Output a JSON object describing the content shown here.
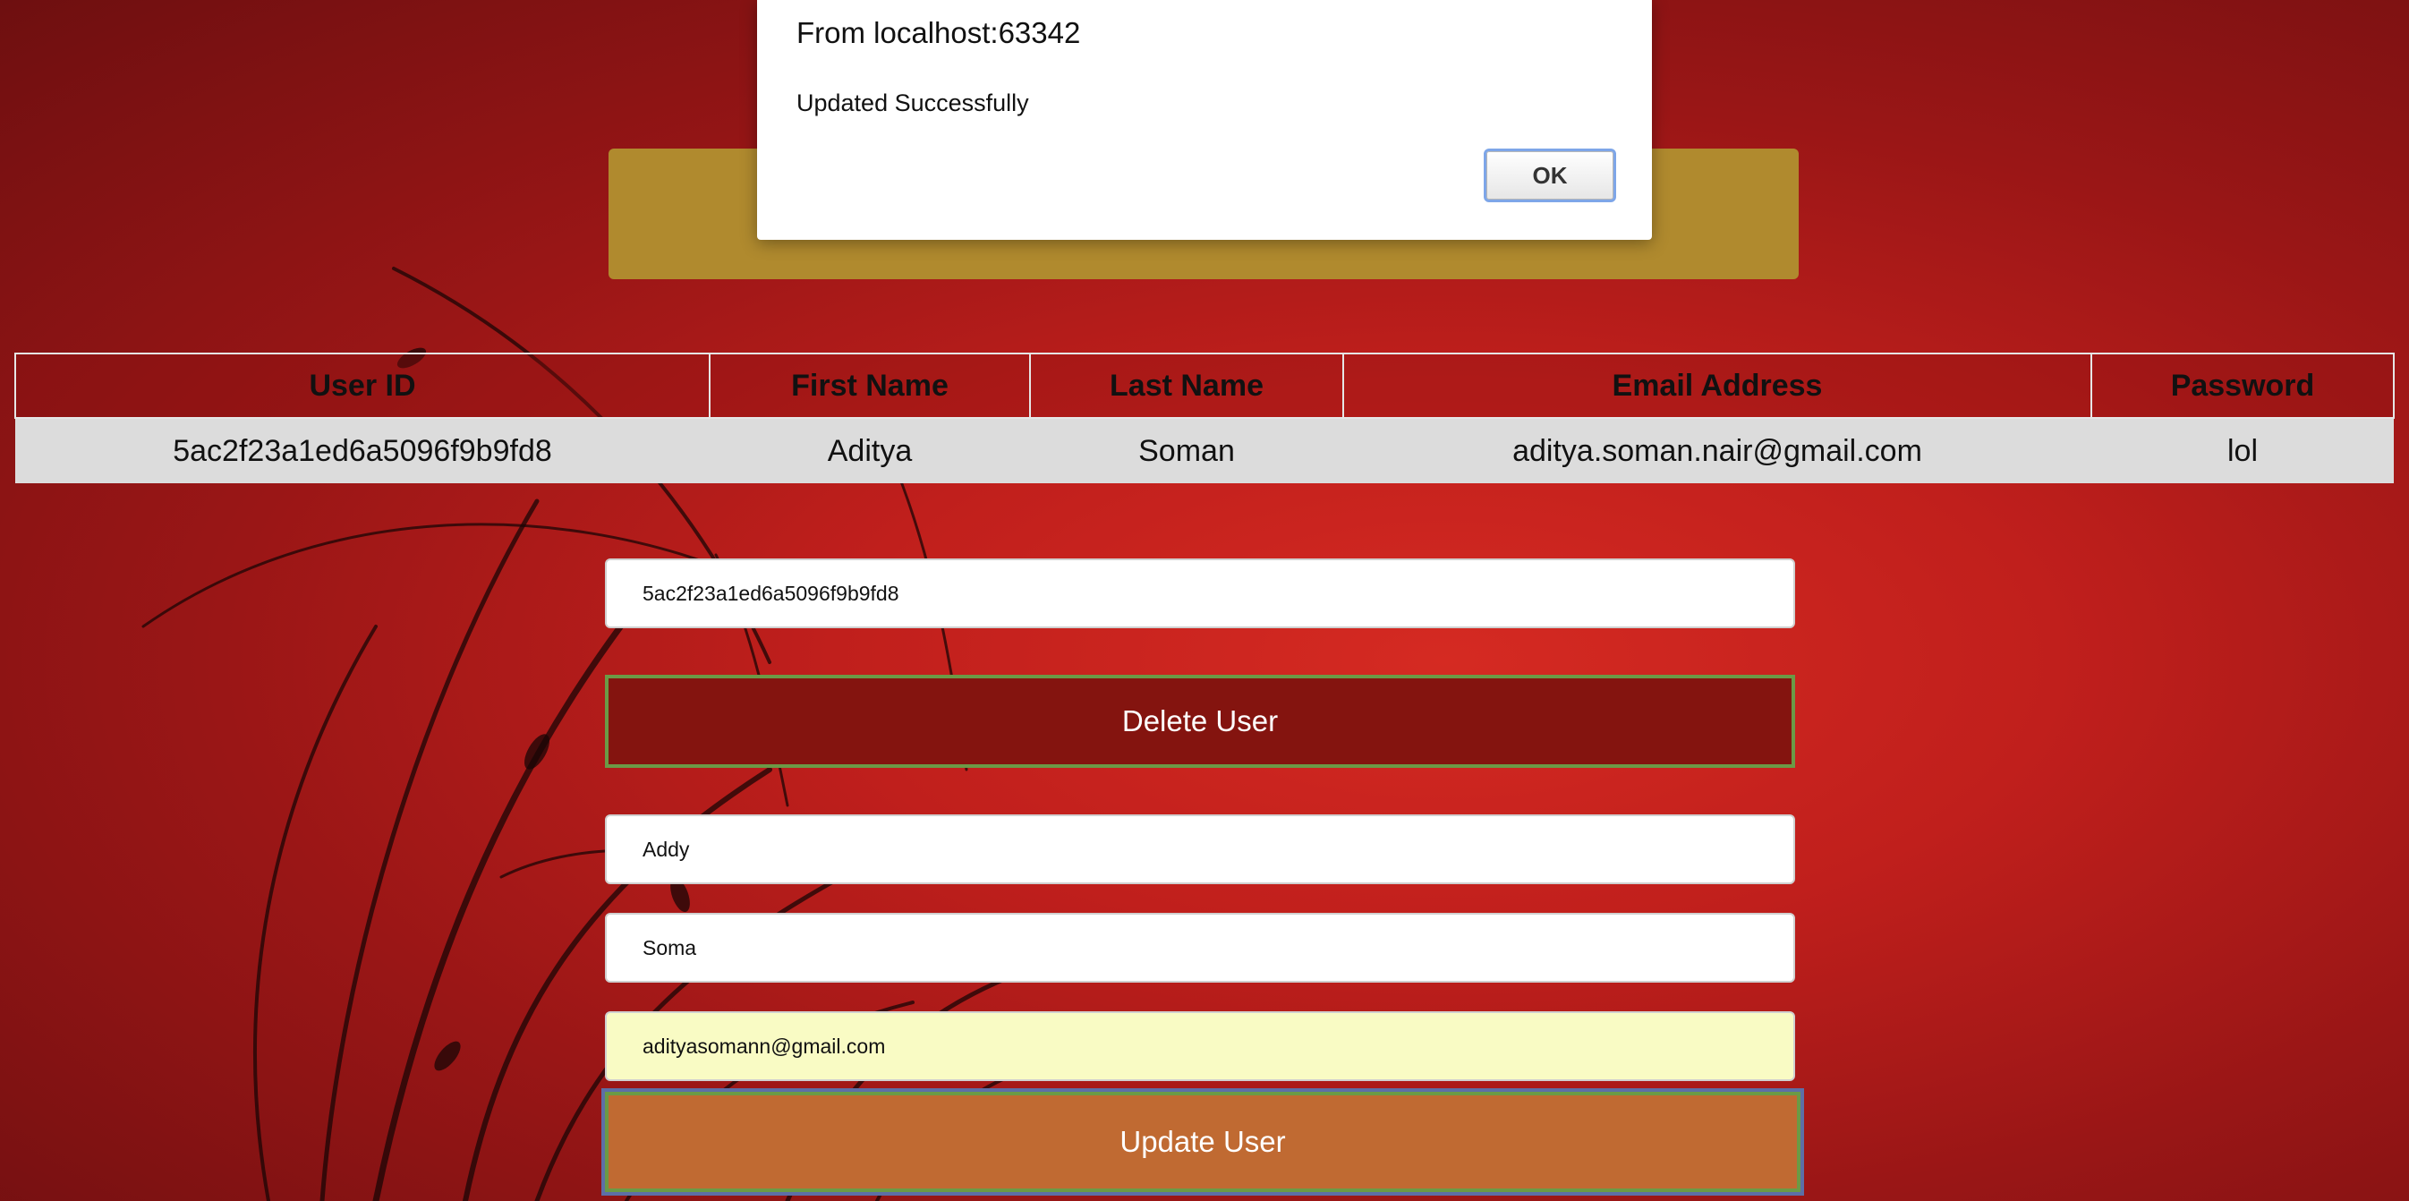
{
  "dialog": {
    "title": "From localhost:63342",
    "message": "Updated Successfully",
    "ok_label": "OK"
  },
  "table": {
    "headers": [
      "User ID",
      "First Name",
      "Last Name",
      "Email Address",
      "Password"
    ],
    "rows": [
      [
        "5ac2f23a1ed6a5096f9b9fd8",
        "Aditya",
        "Soman",
        "aditya.soman.nair@gmail.com",
        "lol"
      ]
    ]
  },
  "form": {
    "user_id_value": "5ac2f23a1ed6a5096f9b9fd8",
    "delete_label": "Delete User",
    "first_name_value": "Addy",
    "last_name_value": "Soma",
    "email_value": "adityasomann@gmail.com",
    "update_label": "Update User"
  },
  "colors": {
    "background": "#c01f1c",
    "banner": "#b08a2e",
    "delete_button": "#84140f",
    "update_button": "#c06a32",
    "autofill": "#f9fbc4"
  }
}
